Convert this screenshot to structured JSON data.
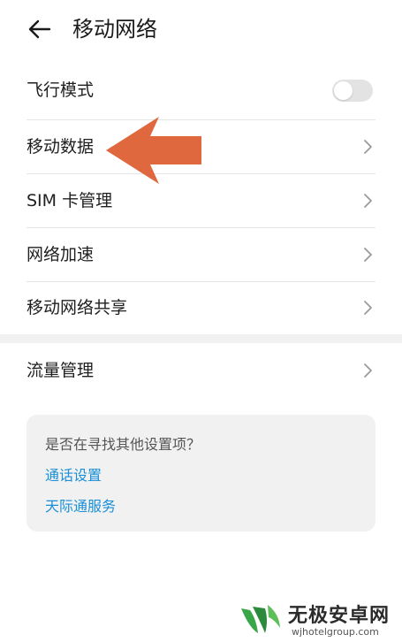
{
  "header": {
    "title": "移动网络",
    "back_icon": "arrow-left-icon"
  },
  "rows": [
    {
      "label": "飞行模式",
      "control": "toggle",
      "toggle_on": false
    },
    {
      "label": "移动数据",
      "control": "chevron"
    },
    {
      "label": "SIM 卡管理",
      "control": "chevron"
    },
    {
      "label": "网络加速",
      "control": "chevron"
    },
    {
      "label": "移动网络共享",
      "control": "chevron"
    }
  ],
  "section2": {
    "label": "流量管理",
    "control": "chevron"
  },
  "suggestions": {
    "title": "是否在寻找其他设置项？",
    "links": [
      "通话设置",
      "天际通服务"
    ]
  },
  "annotation": {
    "icon": "arrow-left-icon",
    "color": "#e0683f"
  },
  "watermark": {
    "main": "无极安卓网",
    "sub": "wjhotelgroup.com"
  },
  "colors": {
    "link": "#1a8fd6",
    "divider": "#e5e5e5",
    "card_bg": "#f1f1f1",
    "toggle_off": "#e3e3e3"
  }
}
